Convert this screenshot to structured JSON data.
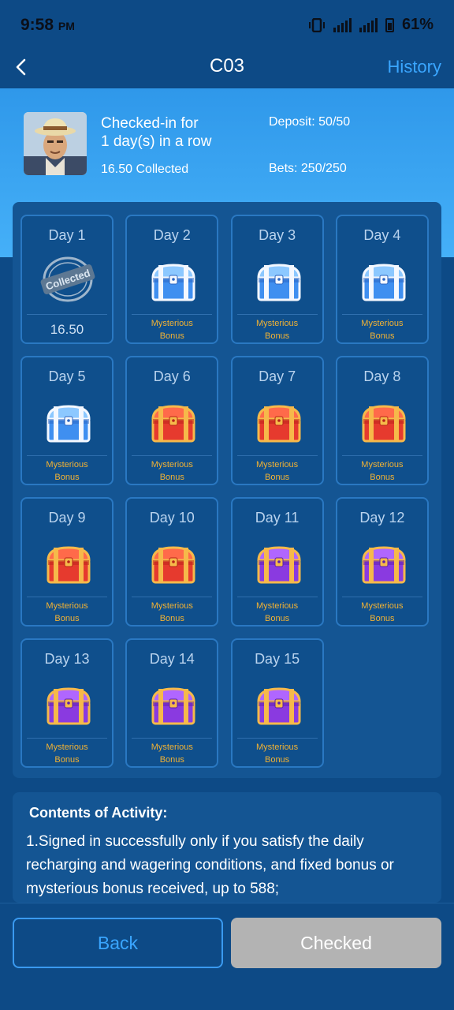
{
  "status_bar": {
    "time": "9:58",
    "ampm": "PM",
    "battery": "61%"
  },
  "nav": {
    "title": "C03",
    "history": "History"
  },
  "summary": {
    "checkin_line1": "Checked-in for",
    "checkin_line2": "1 day(s) in a row",
    "collected": "16.50 Collected",
    "deposit": "Deposit: 50/50",
    "bets": "Bets: 250/250"
  },
  "days": [
    {
      "label": "Day 1",
      "status": "collected",
      "amount": "16.50",
      "stamp_text": "Collected"
    },
    {
      "label": "Day 2",
      "chest": "blue",
      "bonus_line1": "Mysterious",
      "bonus_line2": "Bonus"
    },
    {
      "label": "Day 3",
      "chest": "blue",
      "bonus_line1": "Mysterious",
      "bonus_line2": "Bonus"
    },
    {
      "label": "Day 4",
      "chest": "blue",
      "bonus_line1": "Mysterious",
      "bonus_line2": "Bonus"
    },
    {
      "label": "Day 5",
      "chest": "blue",
      "bonus_line1": "Mysterious",
      "bonus_line2": "Bonus"
    },
    {
      "label": "Day 6",
      "chest": "red",
      "bonus_line1": "Mysterious",
      "bonus_line2": "Bonus"
    },
    {
      "label": "Day 7",
      "chest": "red",
      "bonus_line1": "Mysterious",
      "bonus_line2": "Bonus"
    },
    {
      "label": "Day 8",
      "chest": "red",
      "bonus_line1": "Mysterious",
      "bonus_line2": "Bonus"
    },
    {
      "label": "Day 9",
      "chest": "red",
      "bonus_line1": "Mysterious",
      "bonus_line2": "Bonus"
    },
    {
      "label": "Day 10",
      "chest": "red",
      "bonus_line1": "Mysterious",
      "bonus_line2": "Bonus"
    },
    {
      "label": "Day 11",
      "chest": "purple",
      "bonus_line1": "Mysterious",
      "bonus_line2": "Bonus"
    },
    {
      "label": "Day 12",
      "chest": "purple",
      "bonus_line1": "Mysterious",
      "bonus_line2": "Bonus"
    },
    {
      "label": "Day 13",
      "chest": "purple",
      "bonus_line1": "Mysterious",
      "bonus_line2": "Bonus"
    },
    {
      "label": "Day 14",
      "chest": "purple",
      "bonus_line1": "Mysterious",
      "bonus_line2": "Bonus"
    },
    {
      "label": "Day 15",
      "chest": "purple",
      "bonus_line1": "Mysterious",
      "bonus_line2": "Bonus"
    }
  ],
  "contents": {
    "title": "Contents of Activity:",
    "text": "1.Signed in successfully only if you satisfy the daily recharging and wagering conditions, and fixed bonus or mysterious bonus received, up to 588;"
  },
  "footer": {
    "back": "Back",
    "checked": "Checked"
  },
  "colors": {
    "accent": "#3aa6ff",
    "bonus": "#f2b233",
    "background": "#0d4a86",
    "hero": "#3aa6f2"
  }
}
